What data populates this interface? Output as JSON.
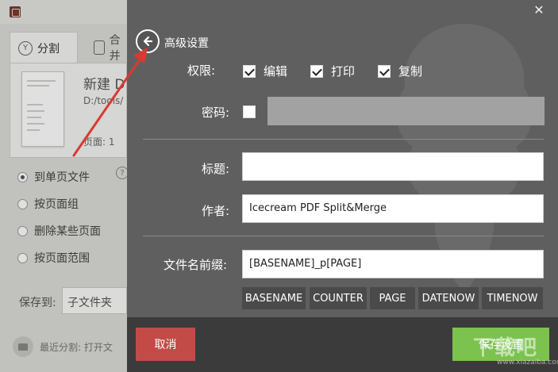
{
  "background": {
    "tabs": [
      {
        "label": "分割",
        "icon": "split-icon"
      },
      {
        "label": "合并",
        "icon": "merge-icon"
      }
    ],
    "document": {
      "name": "新建 D",
      "path": "D:/tools/",
      "pages": "页面: 1"
    },
    "split_modes": [
      {
        "label": "到单页文件",
        "checked": true
      },
      {
        "label": "按页面组",
        "checked": false
      },
      {
        "label": "删除某些页面",
        "checked": false
      },
      {
        "label": "按页面范围",
        "checked": false
      }
    ],
    "save_to_label": "保存到:",
    "save_to_value": "子文件夹",
    "recent_text": "最近分割: 打开文"
  },
  "settings": {
    "title": "高级设置",
    "permissions_label": "权限:",
    "permissions": [
      {
        "label": "编辑",
        "checked": true
      },
      {
        "label": "打印",
        "checked": true
      },
      {
        "label": "复制",
        "checked": true
      }
    ],
    "password_label": "密码:",
    "password_checked": false,
    "title_label": "标题:",
    "title_value": "",
    "author_label": "作者:",
    "author_value": "Icecream PDF Split&Merge",
    "filename_label": "文件名前缀:",
    "filename_value": "[BASENAME]_p[PAGE]",
    "tokens": [
      "BASENAME",
      "COUNTER",
      "PAGE",
      "DATENOW",
      "TIMENOW"
    ],
    "cancel_label": "取消",
    "save_label": "保存设置"
  },
  "colors": {
    "overlay": "#5f5f5f",
    "cancel": "#c24b48",
    "save": "#7bc24e",
    "annotation_arrow": "#d83a32"
  },
  "watermark": {
    "text": "下载吧",
    "sub": "www.xiazaiba.com"
  }
}
